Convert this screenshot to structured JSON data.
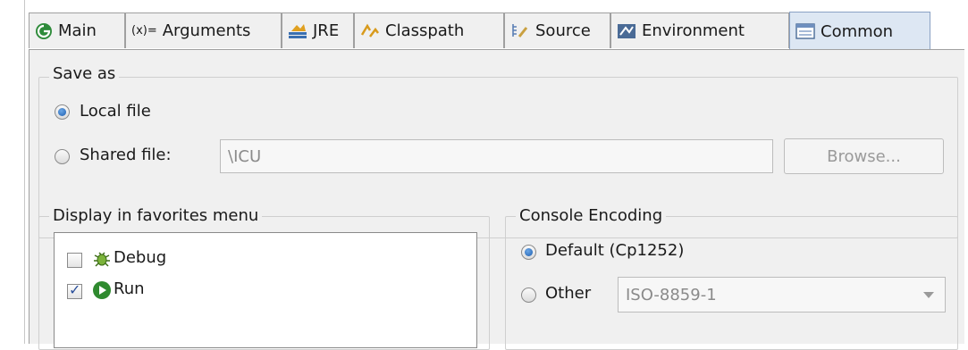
{
  "tabs": [
    {
      "label": "Main",
      "icon": "main-icon"
    },
    {
      "label": "Arguments",
      "icon": "arguments-icon"
    },
    {
      "label": "JRE",
      "icon": "jre-icon"
    },
    {
      "label": "Classpath",
      "icon": "classpath-icon"
    },
    {
      "label": "Source",
      "icon": "source-icon"
    },
    {
      "label": "Environment",
      "icon": "environment-icon"
    },
    {
      "label": "Common",
      "icon": "common-icon",
      "active": true
    }
  ],
  "save_as": {
    "title": "Save as",
    "local_label": "Local file",
    "shared_label": "Shared file:",
    "shared_path": "\\ICU",
    "browse_label": "Browse...",
    "selected": "local"
  },
  "favorites": {
    "title": "Display in favorites menu",
    "items": [
      {
        "label": "Debug",
        "checked": false,
        "icon": "debug-icon"
      },
      {
        "label": "Run",
        "checked": true,
        "icon": "run-icon"
      }
    ]
  },
  "encoding": {
    "title": "Console Encoding",
    "default_label": "Default (Cp1252)",
    "other_label": "Other",
    "other_value": "ISO-8859-1",
    "selected": "default"
  },
  "colors": {
    "panel_bg": "#f0f0f0",
    "active_tab_bg": "#dde7f3",
    "radio_accent": "#1f5fb0"
  }
}
